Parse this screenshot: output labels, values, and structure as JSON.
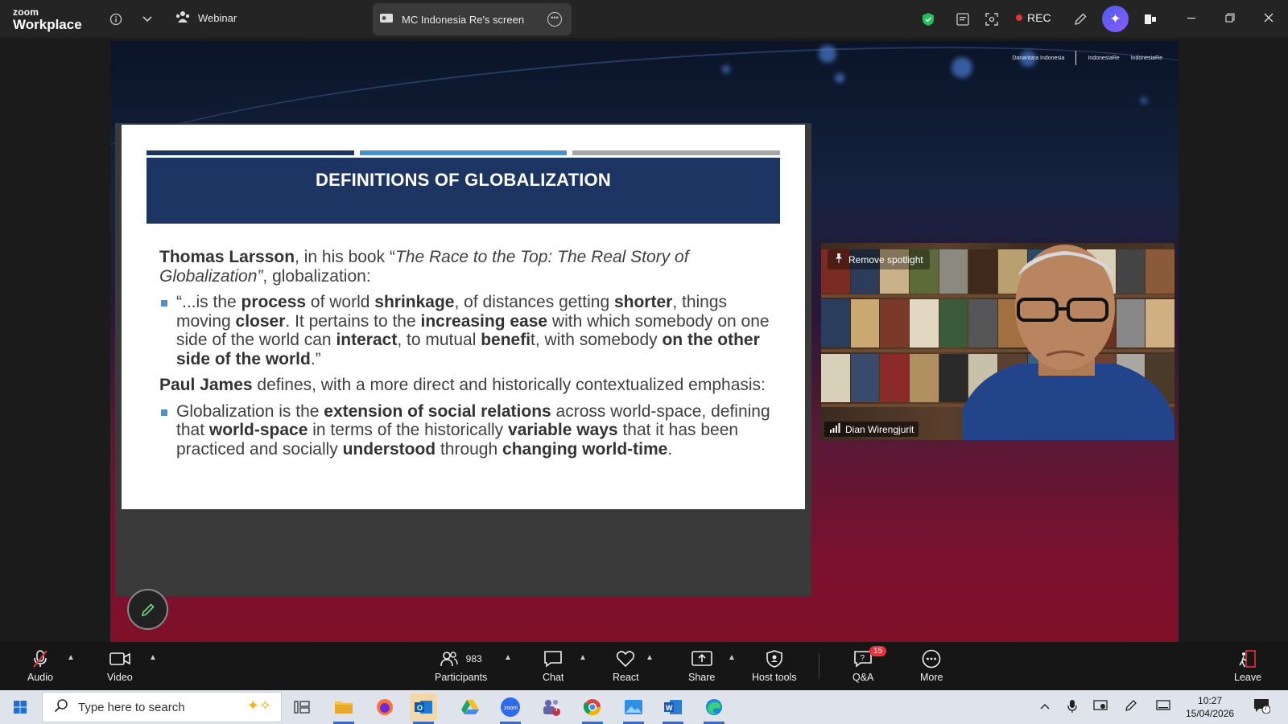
{
  "titlebar": {
    "brand_top": "zoom",
    "brand_bottom": "Workplace",
    "webinar_label": "Webinar",
    "share_tab_label": "MC Indonesia Re's screen",
    "rec_label": "REC"
  },
  "slide": {
    "title": "DEFINITIONS OF GLOBALIZATION",
    "bar_colors": [
      "#1d3563",
      "#4a90c9",
      "#a6a6a6"
    ],
    "p1": {
      "author": "Thomas Larsson",
      "t1": ", in his book “",
      "book": "The Race to the Top: The Real Story of Globalization”",
      "t2": ", globalization:"
    },
    "b1": {
      "t1": "“...is the ",
      "w1": "process",
      "t2": " of world ",
      "w2": "shrinkage",
      "t3": ", of distances getting ",
      "w3": "shorter",
      "t4": ", things moving ",
      "w4": "closer",
      "t5": ". It pertains to the ",
      "w5": "increasing ease",
      "t6": " with which somebody on one side of the world can ",
      "w6": "interact",
      "t7": ", to mutual ",
      "w7": "benefi",
      "t8": "t, with somebody ",
      "w8": "on the other side of the world",
      "t9": ".”"
    },
    "p2": {
      "author": "Paul James",
      "t1": " defines, with a more direct and historically contextualized emphasis:"
    },
    "b2": {
      "t1": "Globalization is the ",
      "w1": "extension of social relations",
      "t2": " across world-space, defining that ",
      "w2": "world-space",
      "t3": " in terms of the historically ",
      "w3": "variable ways",
      "t4": " that it has been practiced and socially ",
      "w4": "understood",
      "t5": " through ",
      "w5": "changing world-time",
      "t6": "."
    }
  },
  "video": {
    "spotlight_label": "Remove spotlight",
    "participant_name": "Dian Wirengjurit"
  },
  "logos": [
    "Danantara Indonesia",
    "IndonesiaRe",
    "IndonesiaRe"
  ],
  "controls": {
    "audio": "Audio",
    "video": "Video",
    "participants": "Participants",
    "participants_count": "983",
    "chat": "Chat",
    "react": "React",
    "share": "Share",
    "host_tools": "Host tools",
    "qa": "Q&A",
    "qa_badge": "15",
    "more": "More",
    "leave": "Leave"
  },
  "taskbar": {
    "search_placeholder": "Type here to search",
    "teams_badge": "7",
    "time": "10:27",
    "date": "15/04/2026",
    "notification_count": "7"
  },
  "colors": {
    "accent_rec": "#e5333d",
    "slide_title_bg": "#1d3563",
    "bullet": "#4a90c9",
    "shield_green": "#1fbf5a"
  }
}
